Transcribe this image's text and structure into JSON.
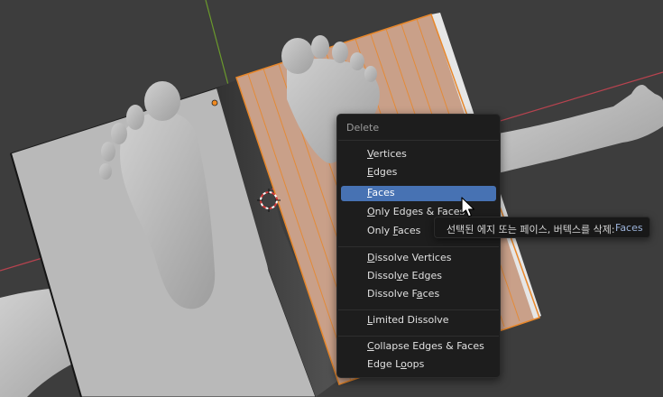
{
  "viewport": {
    "background": "#3d3d3d",
    "axis_x_color": "#b8434f",
    "axis_y_color": "#6b9a2c",
    "selection_color": "#e8872a"
  },
  "menu": {
    "title": "Delete",
    "items": [
      {
        "pre": "",
        "ul": "V",
        "post": "ertices",
        "active": false,
        "icon": ""
      },
      {
        "pre": "",
        "ul": "E",
        "post": "dges",
        "active": false,
        "icon": ""
      },
      {
        "pre": "",
        "ul": "F",
        "post": "aces",
        "active": true,
        "icon": ""
      },
      {
        "pre": "",
        "ul": "O",
        "post": "nly Edges & Faces",
        "active": false,
        "icon": ""
      },
      {
        "pre": "Only ",
        "ul": "F",
        "post": "aces",
        "active": false,
        "icon": ""
      },
      {
        "pre": "",
        "ul": "D",
        "post": "issolve Vertices",
        "active": false,
        "icon": ""
      },
      {
        "pre": "Dissol",
        "ul": "v",
        "post": "e Edges",
        "active": false,
        "icon": ""
      },
      {
        "pre": "Dissolve F",
        "ul": "a",
        "post": "ces",
        "active": false,
        "icon": ""
      },
      {
        "pre": "",
        "ul": "L",
        "post": "imited Dissolve",
        "active": false,
        "icon": ""
      },
      {
        "pre": "",
        "ul": "C",
        "post": "ollapse Edges & Faces",
        "active": false,
        "icon": ""
      },
      {
        "pre": "Edge L",
        "ul": "o",
        "post": "ops",
        "active": false,
        "icon": ""
      }
    ]
  },
  "tooltip": {
    "text": "선택된 에지 또는 페이스, 버텍스를 삭제:",
    "value": "Faces"
  },
  "cursor": {
    "icon": "arrow-pointer-icon"
  }
}
